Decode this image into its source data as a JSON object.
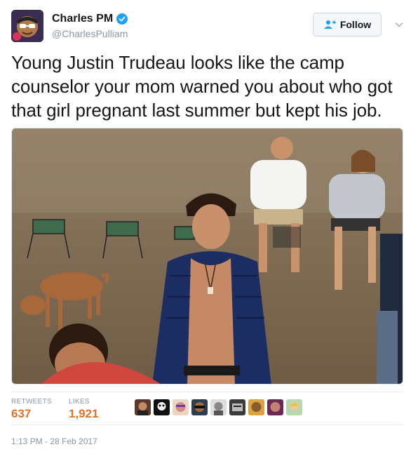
{
  "user": {
    "display_name": "Charles PM",
    "handle": "@CharlesPulliam",
    "verified": true
  },
  "follow": {
    "label": "Follow"
  },
  "tweet": {
    "text": "Young Justin Trudeau looks like the camp counselor your mom warned you about who got that girl pregnant last summer but kept his job."
  },
  "stats": {
    "retweets_label": "RETWEETS",
    "retweets_count": "637",
    "likes_label": "LIKES",
    "likes_count": "1,921"
  },
  "likers": [
    {
      "icon": "liker-avatar"
    },
    {
      "icon": "liker-avatar"
    },
    {
      "icon": "liker-avatar"
    },
    {
      "icon": "liker-avatar"
    },
    {
      "icon": "liker-avatar"
    },
    {
      "icon": "liker-avatar"
    },
    {
      "icon": "liker-avatar"
    },
    {
      "icon": "liker-avatar"
    },
    {
      "icon": "liker-avatar"
    }
  ],
  "timestamp": "1:13 PM - 28 Feb 2017",
  "colors": {
    "accent": "#1da1f2",
    "stat_value": "#e0722a",
    "muted": "#8899a6"
  }
}
